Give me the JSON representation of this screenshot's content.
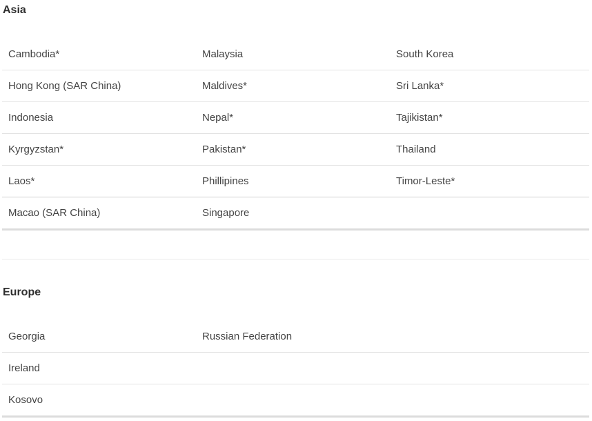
{
  "asia": {
    "title": "Asia",
    "rows": [
      [
        "Cambodia*",
        "Malaysia",
        "South Korea"
      ],
      [
        "Hong Kong (SAR China)",
        "Maldives*",
        "Sri Lanka*"
      ],
      [
        "Indonesia",
        "Nepal*",
        "Tajikistan*"
      ],
      [
        "Kyrgyzstan*",
        "Pakistan*",
        "Thailand"
      ],
      [
        "Laos*",
        "Phillipines",
        "Timor-Leste*"
      ],
      [
        "Macao (SAR China)",
        "Singapore",
        ""
      ]
    ]
  },
  "europe": {
    "title": "Europe",
    "rows": [
      [
        "Georgia",
        "Russian Federation",
        ""
      ],
      [
        "Ireland",
        "",
        ""
      ],
      [
        "Kosovo",
        "",
        ""
      ]
    ]
  }
}
